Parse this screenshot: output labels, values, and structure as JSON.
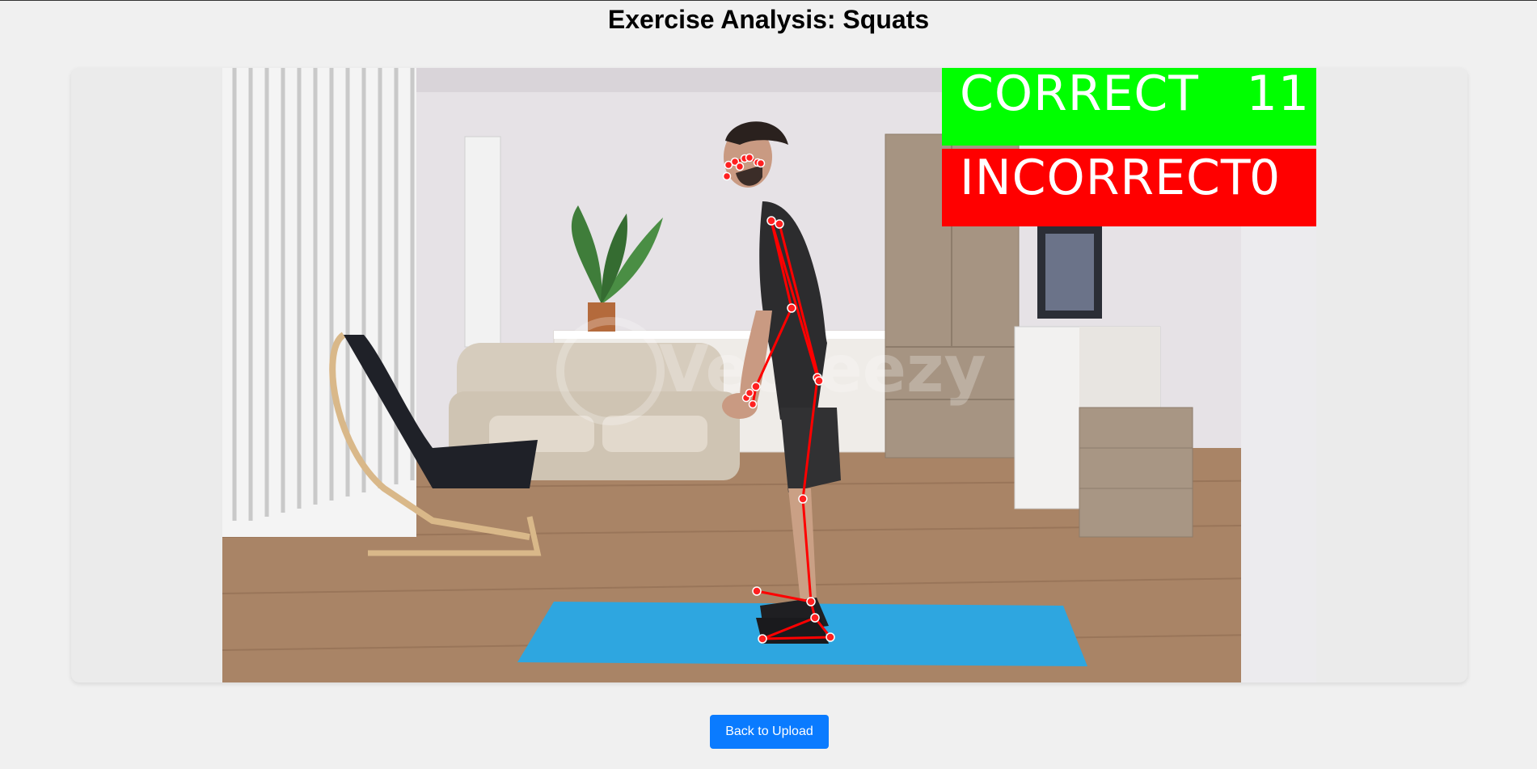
{
  "page": {
    "title": "Exercise Analysis: Squats"
  },
  "video": {
    "watermark": "Vecteezy",
    "counters": {
      "correct_label": "CORRECT",
      "correct_value": "11",
      "incorrect_label": "INCORRECT",
      "incorrect_value": "0"
    }
  },
  "actions": {
    "back_label": "Back to Upload"
  },
  "colors": {
    "background": "#f0f0f0",
    "correct": "#00ff00",
    "incorrect": "#ff0000",
    "button": "#0a7bff",
    "skeleton": "#ff0000"
  }
}
